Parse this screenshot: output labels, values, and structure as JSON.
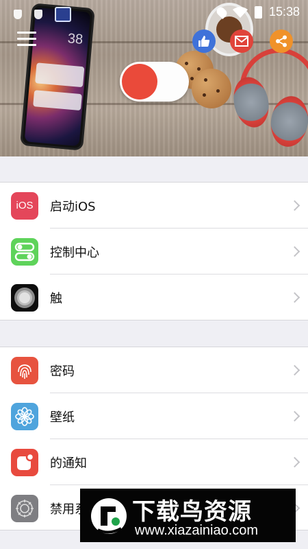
{
  "status_bar": {
    "time": "15:38"
  },
  "banner": {
    "phone_time": "38",
    "toggle_state": "off"
  },
  "groups": [
    {
      "items": [
        {
          "label": "启动iOS",
          "icon": "ios-icon",
          "icon_text": "iOS"
        },
        {
          "label": "控制中心",
          "icon": "control-center-icon"
        },
        {
          "label": "触",
          "icon": "assistive-touch-icon"
        }
      ]
    },
    {
      "items": [
        {
          "label": "密码",
          "icon": "fingerprint-icon"
        },
        {
          "label": "壁纸",
          "icon": "flower-icon"
        },
        {
          "label": "的通知",
          "icon": "notification-icon"
        },
        {
          "label": "禁用系",
          "icon": "gear-icon"
        }
      ]
    }
  ],
  "watermark": {
    "title": "下载鸟资源",
    "url": "www.xiazainiao.com"
  },
  "colors": {
    "accent_red": "#e7533f",
    "like_blue": "#3f72d9",
    "share_orange": "#f0922a",
    "background": "#efeff4"
  }
}
